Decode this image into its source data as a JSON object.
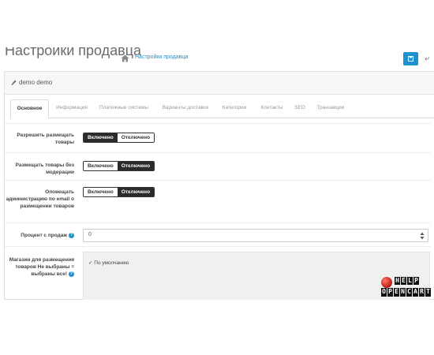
{
  "header": {
    "title": "Настройки продавца",
    "breadcrumb_separator": "›",
    "breadcrumb_label": "Настройки продавца",
    "back_label": "⤶"
  },
  "panel": {
    "title": "demo demo"
  },
  "tabs": [
    {
      "label": "Основное",
      "active": true
    },
    {
      "label": "Информация",
      "active": false
    },
    {
      "label": "Платежные системы",
      "active": false
    },
    {
      "label": "Варианты доставок",
      "active": false
    },
    {
      "label": "Категории",
      "active": false
    },
    {
      "label": "Контакты",
      "active": false
    },
    {
      "label": "SEO",
      "active": false
    },
    {
      "label": "Транзакции",
      "active": false
    }
  ],
  "form": {
    "allow_products": {
      "label": "Разрешить размещать товары",
      "on_label": "Включено",
      "off_label": "Отключено",
      "selected": "on"
    },
    "no_moderation": {
      "label": "Размещать товары без модерации",
      "on_label": "Включено",
      "off_label": "Отключено",
      "selected": "off"
    },
    "notify_admin": {
      "label": "Оповещать администрацию по email о размещении товаров",
      "on_label": "Включено",
      "off_label": "Отключено",
      "selected": "off"
    },
    "commission": {
      "label": "Процент с продаж",
      "value": "0"
    },
    "stores": {
      "label": "Магазин для размещения товаров Не выбраны = выбраны все!",
      "check_mark": "✓",
      "default_option": "По умолчанию"
    }
  },
  "watermark": {
    "line1": [
      "H",
      "E",
      "L",
      "P"
    ],
    "line2": [
      "O",
      "P",
      "E",
      "N",
      "C",
      "A",
      "R",
      "T"
    ]
  },
  "colors": {
    "accent": "#1e91cf",
    "toggle_active": "#2b2b2b",
    "store_box_bg": "#f0f0f0"
  }
}
